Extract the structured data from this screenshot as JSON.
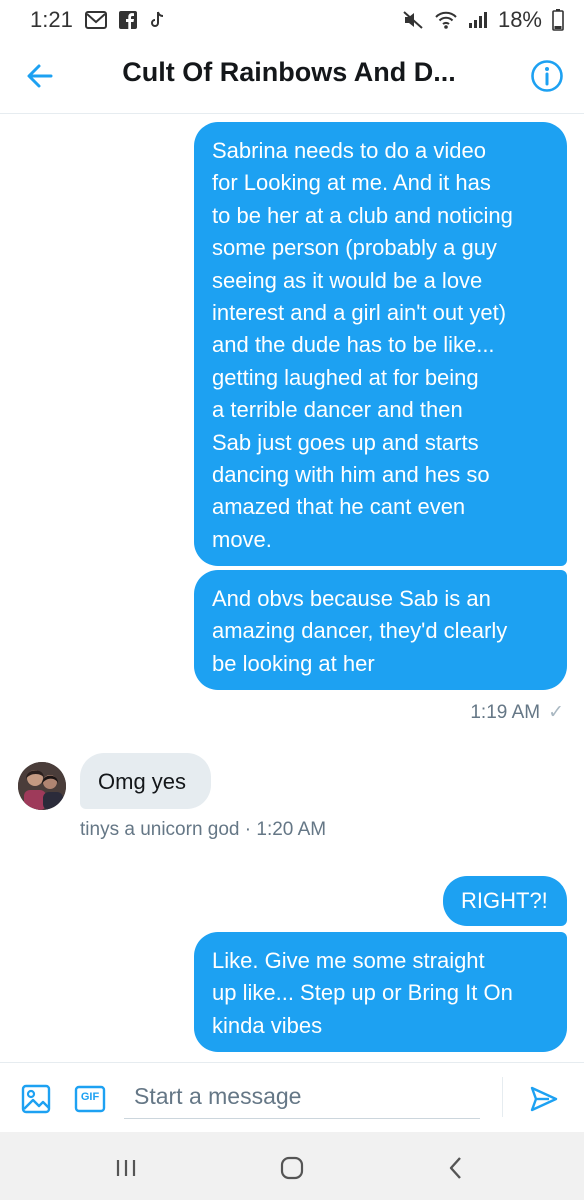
{
  "status_bar": {
    "time": "1:21",
    "battery": "18%",
    "icons": [
      "gmail-icon",
      "facebook-icon",
      "tiktok-icon",
      "mute-icon",
      "wifi-icon",
      "signal-icon",
      "battery-icon"
    ]
  },
  "header": {
    "title": "Cult Of Rainbows And D...",
    "back_icon": "arrow-left-icon",
    "info_icon": "info-icon"
  },
  "messages": [
    {
      "direction": "outgoing",
      "lines": [
        "Sabrina needs to do a video",
        "for Looking at me. And it has",
        "to be her at a club and noticing",
        "some person (probably a guy",
        "seeing as it would be a love",
        "interest and a girl ain't out yet)",
        "and the dude has to be like...",
        "getting laughed at for being",
        "a terrible dancer and then",
        "Sab just goes up and starts",
        "dancing with him and hes so",
        "amazed that he cant even",
        "move."
      ]
    },
    {
      "direction": "outgoing",
      "lines": [
        "And obvs because Sab is an",
        "amazing dancer, they'd clearly",
        "be looking at her"
      ]
    },
    {
      "direction": "incoming",
      "lines": [
        "Omg yes"
      ]
    },
    {
      "direction": "outgoing",
      "lines": [
        "RIGHT?!"
      ]
    },
    {
      "direction": "outgoing",
      "lines": [
        "Like. Give me some straight",
        "up like... Step up or Bring It On",
        "kinda vibes"
      ]
    }
  ],
  "outgoing_meta": {
    "time": "1:19 AM",
    "check": "✓"
  },
  "incoming_meta": {
    "text": "tinys a unicorn god · 1:20 AM"
  },
  "composer": {
    "placeholder": "Start a message",
    "gif_label": "GIF",
    "image_icon": "image-icon",
    "send_icon": "send-icon"
  },
  "nav_bar": {
    "items": [
      "recent-apps-icon",
      "home-icon",
      "back-nav-icon"
    ]
  },
  "colors": {
    "accent": "#1da1f2",
    "incoming_bubble": "#e6ecf0",
    "meta_text": "#657786"
  }
}
